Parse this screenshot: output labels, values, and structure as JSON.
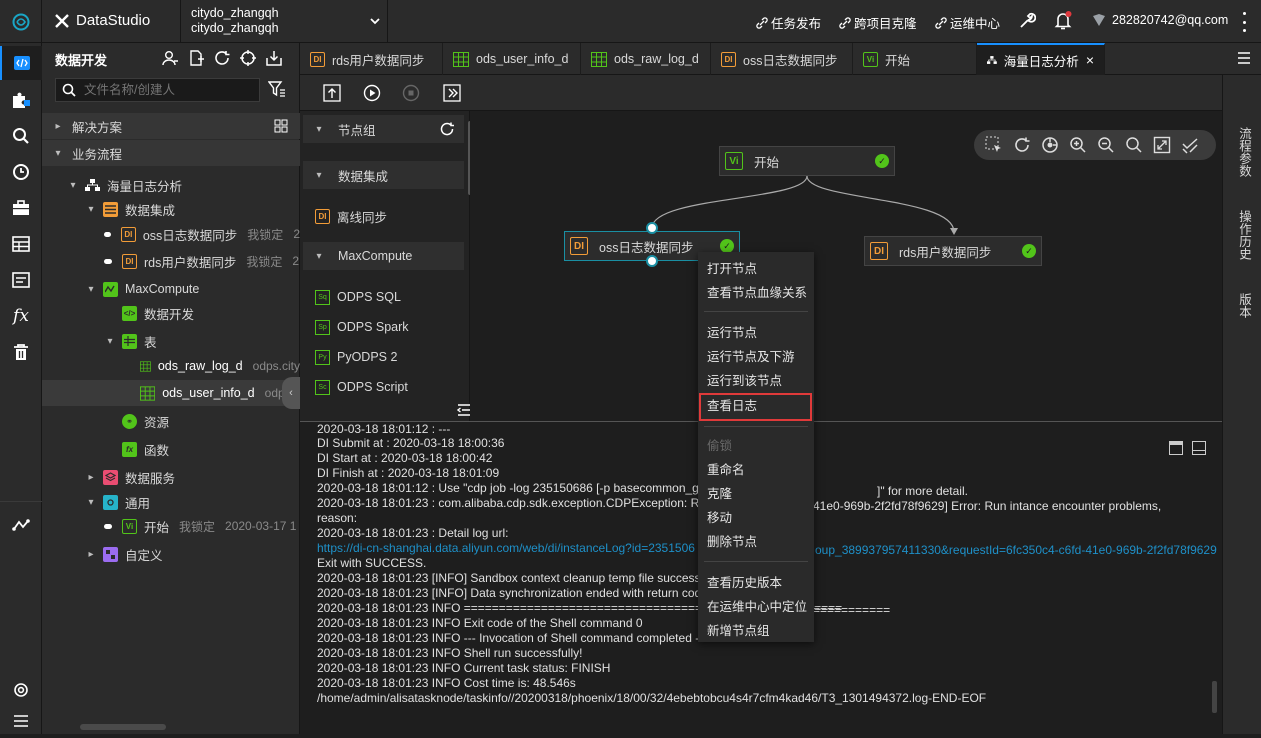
{
  "app": {
    "title": "DataStudio",
    "project_line1": "citydo_zhangqh",
    "project_line2": "citydo_zhangqh"
  },
  "header": {
    "links": [
      "任务发布",
      "跨项目克隆",
      "运维中心"
    ],
    "user": "282820742@qq.com"
  },
  "panel": {
    "title": "数据开发",
    "search_placeholder": "文件名称/创建人"
  },
  "tree": {
    "solutions": "解决方案",
    "business_flow": "业务流程",
    "flow_name": "海量日志分析",
    "data_integration": "数据集成",
    "oss_node": {
      "name": "oss日志数据同步",
      "lock": "我锁定",
      "time": "2"
    },
    "rds_node": {
      "name": "rds用户数据同步",
      "lock": "我锁定",
      "time": "2"
    },
    "maxcompute": "MaxCompute",
    "data_dev": "数据开发",
    "table": "表",
    "raw_log": {
      "name": "ods_raw_log_d",
      "src": "odps.city"
    },
    "user_info": {
      "name": "ods_user_info_d",
      "src": "odps.c"
    },
    "resource": "资源",
    "function": "函数",
    "data_service": "数据服务",
    "general": "通用",
    "start_node": {
      "name": "开始",
      "lock": "我锁定",
      "time": "2020-03-17 1"
    },
    "custom": "自定义"
  },
  "tabs": [
    {
      "label": "rds用户数据同步",
      "icon": "DI"
    },
    {
      "label": "ods_user_info_d",
      "icon": "table"
    },
    {
      "label": "ods_raw_log_d",
      "icon": "table"
    },
    {
      "label": "oss日志数据同步",
      "icon": "DI"
    },
    {
      "label": "开始",
      "icon": "Vi"
    },
    {
      "label": "海量日志分析",
      "icon": "flow"
    }
  ],
  "palette": {
    "node_group": "节点组",
    "data_integration": "数据集成",
    "offline_sync": "离线同步",
    "maxcompute": "MaxCompute",
    "items": [
      {
        "label": "ODPS SQL",
        "icon": "Sq"
      },
      {
        "label": "ODPS Spark",
        "icon": "Sp"
      },
      {
        "label": "PyODPS 2",
        "icon": "Py"
      },
      {
        "label": "ODPS Script",
        "icon": "Sc"
      }
    ]
  },
  "canvas": {
    "start": "开始",
    "oss": "oss日志数据同步",
    "rds": "rds用户数据同步"
  },
  "right_panel": {
    "flow_params": "流程参数",
    "history": "操作历史",
    "version": "版本"
  },
  "context_menu": {
    "items_a": [
      "打开节点",
      "查看节点血缘关系"
    ],
    "items_b": [
      "运行节点",
      "运行节点及下游",
      "运行到该节点",
      "查看日志"
    ],
    "disabled": "偷锁",
    "items_c": [
      "重命名",
      "克隆",
      "移动",
      "删除节点"
    ],
    "items_d": [
      "查看历史版本",
      "在运维中心中定位",
      "新增节点组"
    ]
  },
  "log": {
    "lines": [
      "2020-03-18 18:01:12 : ---",
      "DI Submit at : 2020-03-18 18:00:36",
      "DI Start at : 2020-03-18 18:00:42",
      "DI Finish at : 2020-03-18 18:01:09",
      "2020-03-18 18:01:12 : Use \"cdp job -log 235150686 [-p basecommon_grou",
      "2020-03-18 18:01:23 : com.alibaba.cdp.sdk.exception.CDPException: Req",
      "reason:",
      "2020-03-18 18:01:23 : Detail log url:",
      "https://di-cn-shanghai.data.aliyun.com/web/di/instanceLog?id=2351506",
      "Exit with SUCCESS.",
      "2020-03-18 18:01:23 [INFO] Sandbox context cleanup temp file success.",
      "2020-03-18 18:01:23 [INFO] Data synchronization ended with return code:",
      "2020-03-18 18:01:23 INFO ======================================================",
      "2020-03-18 18:01:23 INFO Exit code of the Shell command 0",
      "2020-03-18 18:01:23 INFO --- Invocation of Shell command completed ---",
      "2020-03-18 18:01:23 INFO Shell run successfully!",
      "2020-03-18 18:01:23 INFO Current task status: FINISH",
      "2020-03-18 18:01:23 INFO Cost time is: 48.546s",
      "/home/admin/alisatasknode/taskinfo//20200318/phoenix/18/00/32/4ebebtobcu4s4r7cfm4kad46/T3_1301494372.log-END-EOF"
    ],
    "tail_more_detail": "]\" for more detail.",
    "tail_error": "41e0-969b-2f2fd78f9629] Error: Run intance encounter problems,",
    "tail_url": "oup_389937957411330&requestId=6fc350c4-c6fd-41e0-969b-2f2fd78f9629",
    "tail_equals": "==========="
  },
  "colors": {
    "accent": "#1890ff",
    "success": "#52c41a",
    "di": "#f29c38",
    "highlight": "#e03a3a"
  }
}
